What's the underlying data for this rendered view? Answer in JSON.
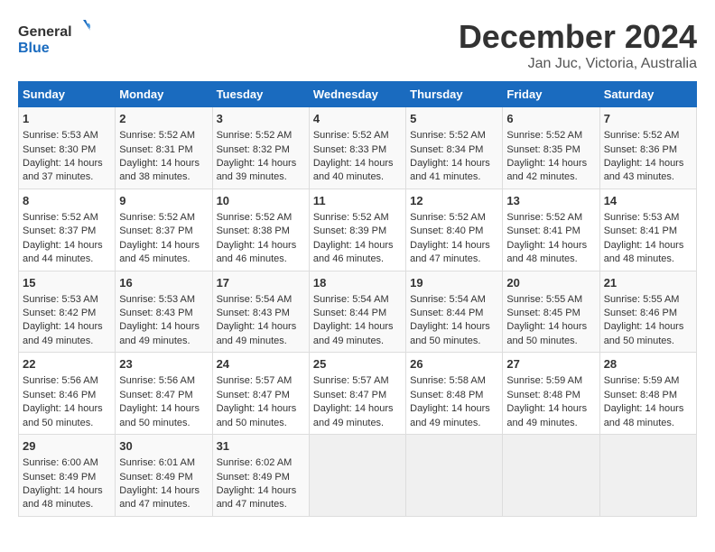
{
  "logo": {
    "text_general": "General",
    "text_blue": "Blue"
  },
  "title": "December 2024",
  "subtitle": "Jan Juc, Victoria, Australia",
  "days_of_week": [
    "Sunday",
    "Monday",
    "Tuesday",
    "Wednesday",
    "Thursday",
    "Friday",
    "Saturday"
  ],
  "weeks": [
    [
      {
        "day": "1",
        "sunrise": "Sunrise: 5:53 AM",
        "sunset": "Sunset: 8:30 PM",
        "daylight": "Daylight: 14 hours and 37 minutes."
      },
      {
        "day": "2",
        "sunrise": "Sunrise: 5:52 AM",
        "sunset": "Sunset: 8:31 PM",
        "daylight": "Daylight: 14 hours and 38 minutes."
      },
      {
        "day": "3",
        "sunrise": "Sunrise: 5:52 AM",
        "sunset": "Sunset: 8:32 PM",
        "daylight": "Daylight: 14 hours and 39 minutes."
      },
      {
        "day": "4",
        "sunrise": "Sunrise: 5:52 AM",
        "sunset": "Sunset: 8:33 PM",
        "daylight": "Daylight: 14 hours and 40 minutes."
      },
      {
        "day": "5",
        "sunrise": "Sunrise: 5:52 AM",
        "sunset": "Sunset: 8:34 PM",
        "daylight": "Daylight: 14 hours and 41 minutes."
      },
      {
        "day": "6",
        "sunrise": "Sunrise: 5:52 AM",
        "sunset": "Sunset: 8:35 PM",
        "daylight": "Daylight: 14 hours and 42 minutes."
      },
      {
        "day": "7",
        "sunrise": "Sunrise: 5:52 AM",
        "sunset": "Sunset: 8:36 PM",
        "daylight": "Daylight: 14 hours and 43 minutes."
      }
    ],
    [
      {
        "day": "8",
        "sunrise": "Sunrise: 5:52 AM",
        "sunset": "Sunset: 8:37 PM",
        "daylight": "Daylight: 14 hours and 44 minutes."
      },
      {
        "day": "9",
        "sunrise": "Sunrise: 5:52 AM",
        "sunset": "Sunset: 8:37 PM",
        "daylight": "Daylight: 14 hours and 45 minutes."
      },
      {
        "day": "10",
        "sunrise": "Sunrise: 5:52 AM",
        "sunset": "Sunset: 8:38 PM",
        "daylight": "Daylight: 14 hours and 46 minutes."
      },
      {
        "day": "11",
        "sunrise": "Sunrise: 5:52 AM",
        "sunset": "Sunset: 8:39 PM",
        "daylight": "Daylight: 14 hours and 46 minutes."
      },
      {
        "day": "12",
        "sunrise": "Sunrise: 5:52 AM",
        "sunset": "Sunset: 8:40 PM",
        "daylight": "Daylight: 14 hours and 47 minutes."
      },
      {
        "day": "13",
        "sunrise": "Sunrise: 5:52 AM",
        "sunset": "Sunset: 8:41 PM",
        "daylight": "Daylight: 14 hours and 48 minutes."
      },
      {
        "day": "14",
        "sunrise": "Sunrise: 5:53 AM",
        "sunset": "Sunset: 8:41 PM",
        "daylight": "Daylight: 14 hours and 48 minutes."
      }
    ],
    [
      {
        "day": "15",
        "sunrise": "Sunrise: 5:53 AM",
        "sunset": "Sunset: 8:42 PM",
        "daylight": "Daylight: 14 hours and 49 minutes."
      },
      {
        "day": "16",
        "sunrise": "Sunrise: 5:53 AM",
        "sunset": "Sunset: 8:43 PM",
        "daylight": "Daylight: 14 hours and 49 minutes."
      },
      {
        "day": "17",
        "sunrise": "Sunrise: 5:54 AM",
        "sunset": "Sunset: 8:43 PM",
        "daylight": "Daylight: 14 hours and 49 minutes."
      },
      {
        "day": "18",
        "sunrise": "Sunrise: 5:54 AM",
        "sunset": "Sunset: 8:44 PM",
        "daylight": "Daylight: 14 hours and 49 minutes."
      },
      {
        "day": "19",
        "sunrise": "Sunrise: 5:54 AM",
        "sunset": "Sunset: 8:44 PM",
        "daylight": "Daylight: 14 hours and 50 minutes."
      },
      {
        "day": "20",
        "sunrise": "Sunrise: 5:55 AM",
        "sunset": "Sunset: 8:45 PM",
        "daylight": "Daylight: 14 hours and 50 minutes."
      },
      {
        "day": "21",
        "sunrise": "Sunrise: 5:55 AM",
        "sunset": "Sunset: 8:46 PM",
        "daylight": "Daylight: 14 hours and 50 minutes."
      }
    ],
    [
      {
        "day": "22",
        "sunrise": "Sunrise: 5:56 AM",
        "sunset": "Sunset: 8:46 PM",
        "daylight": "Daylight: 14 hours and 50 minutes."
      },
      {
        "day": "23",
        "sunrise": "Sunrise: 5:56 AM",
        "sunset": "Sunset: 8:47 PM",
        "daylight": "Daylight: 14 hours and 50 minutes."
      },
      {
        "day": "24",
        "sunrise": "Sunrise: 5:57 AM",
        "sunset": "Sunset: 8:47 PM",
        "daylight": "Daylight: 14 hours and 50 minutes."
      },
      {
        "day": "25",
        "sunrise": "Sunrise: 5:57 AM",
        "sunset": "Sunset: 8:47 PM",
        "daylight": "Daylight: 14 hours and 49 minutes."
      },
      {
        "day": "26",
        "sunrise": "Sunrise: 5:58 AM",
        "sunset": "Sunset: 8:48 PM",
        "daylight": "Daylight: 14 hours and 49 minutes."
      },
      {
        "day": "27",
        "sunrise": "Sunrise: 5:59 AM",
        "sunset": "Sunset: 8:48 PM",
        "daylight": "Daylight: 14 hours and 49 minutes."
      },
      {
        "day": "28",
        "sunrise": "Sunrise: 5:59 AM",
        "sunset": "Sunset: 8:48 PM",
        "daylight": "Daylight: 14 hours and 48 minutes."
      }
    ],
    [
      {
        "day": "29",
        "sunrise": "Sunrise: 6:00 AM",
        "sunset": "Sunset: 8:49 PM",
        "daylight": "Daylight: 14 hours and 48 minutes."
      },
      {
        "day": "30",
        "sunrise": "Sunrise: 6:01 AM",
        "sunset": "Sunset: 8:49 PM",
        "daylight": "Daylight: 14 hours and 47 minutes."
      },
      {
        "day": "31",
        "sunrise": "Sunrise: 6:02 AM",
        "sunset": "Sunset: 8:49 PM",
        "daylight": "Daylight: 14 hours and 47 minutes."
      },
      null,
      null,
      null,
      null
    ]
  ]
}
